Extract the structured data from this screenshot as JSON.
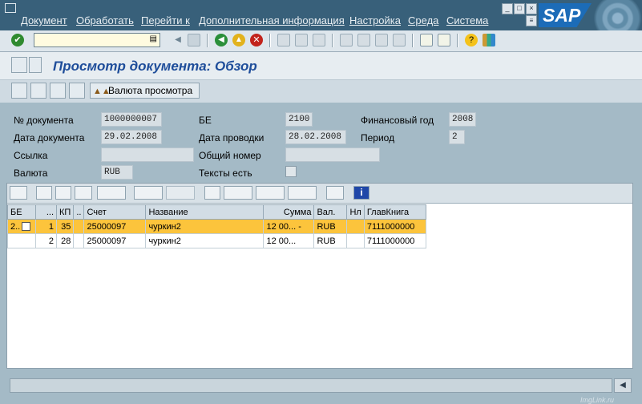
{
  "menu": [
    "Документ",
    "Обработать",
    "Перейти к",
    "Дополнительная информация",
    "Настройка",
    "Среда",
    "Система"
  ],
  "brand": {
    "logo_text": "SAP",
    "color": "#1c6cb8"
  },
  "command_field": {
    "value": ""
  },
  "title": "Просмотр документа: Обзор",
  "app_toolbar": {
    "currency_button": "Валюта просмотра"
  },
  "header": {
    "doc_no": {
      "label": "№ документа",
      "value": "1000000007"
    },
    "doc_date": {
      "label": "Дата документа",
      "value": "29.02.2008"
    },
    "reference": {
      "label": "Ссылка",
      "value": ""
    },
    "currency": {
      "label": "Валюта",
      "value": "RUB"
    },
    "company_code": {
      "label": "БЕ",
      "value": "2100"
    },
    "posting_date": {
      "label": "Дата проводки",
      "value": "28.02.2008"
    },
    "cross_number": {
      "label": "Общий номер",
      "value": ""
    },
    "texts": {
      "label": "Тексты есть",
      "checked": false
    },
    "fiscal_year": {
      "label": "Финансовый год",
      "value": "2008"
    },
    "period": {
      "label": "Период",
      "value": "2"
    }
  },
  "grid": {
    "columns": [
      "БЕ",
      "...",
      "КП",
      "..",
      "Счет",
      "Название",
      "Сумма",
      "Вал.",
      "Нл",
      "ГлавКнига"
    ],
    "rows": [
      {
        "be": "2..",
        "item": "1",
        "pk": "35",
        "s": "",
        "account": "25000097",
        "name": "чуркин2",
        "amount": "12 00...",
        "sign": "-",
        "cur": "RUB",
        "tax": "",
        "gl": "7111000000",
        "selected": true
      },
      {
        "be": "",
        "item": "2",
        "pk": "28",
        "s": "",
        "account": "25000097",
        "name": "чуркин2",
        "amount": "12 00...",
        "sign": "",
        "cur": "RUB",
        "tax": "",
        "gl": "7111000000",
        "selected": false
      }
    ]
  },
  "watermark": "ImgLink.ru",
  "colors": {
    "menubar": "#38607a",
    "selection": "#fcc43c",
    "background": "#a4bac6"
  }
}
